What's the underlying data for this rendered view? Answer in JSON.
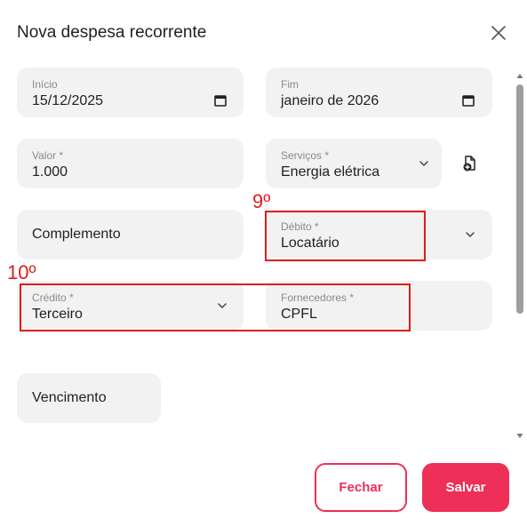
{
  "dialog": {
    "title": "Nova despesa recorrente",
    "close_icon": "close-icon"
  },
  "form": {
    "inicio": {
      "label": "Início",
      "value": "15/12/2025",
      "icon": "calendar-icon"
    },
    "fim": {
      "label": "Fim",
      "value": "janeiro de 2026",
      "icon": "calendar-icon"
    },
    "valor": {
      "label": "Valor *",
      "value": "1.000"
    },
    "servicos": {
      "label": "Serviços *",
      "value": "Energia elétrica",
      "icon": "chevron-down-icon",
      "action_icon": "file-add-icon"
    },
    "complemento": {
      "placeholder": "Complemento"
    },
    "debito": {
      "label": "Débito *",
      "value": "Locatário",
      "icon": "chevron-down-icon"
    },
    "credito": {
      "label": "Crédito *",
      "value": "Terceiro",
      "icon": "chevron-down-icon"
    },
    "fornecedores": {
      "label": "Fornecedores *",
      "value": "CPFL"
    },
    "vencimento": {
      "placeholder": "Vencimento"
    }
  },
  "annotations": [
    {
      "label": "9º",
      "color": "#e01b1b"
    },
    {
      "label": "10º",
      "color": "#e01b1b"
    }
  ],
  "buttons": {
    "close_label": "Fechar",
    "save_label": "Salvar"
  },
  "colors": {
    "accent": "#ee2f57",
    "field_bg": "#f2f2f2",
    "annotation": "#e01b1b"
  }
}
